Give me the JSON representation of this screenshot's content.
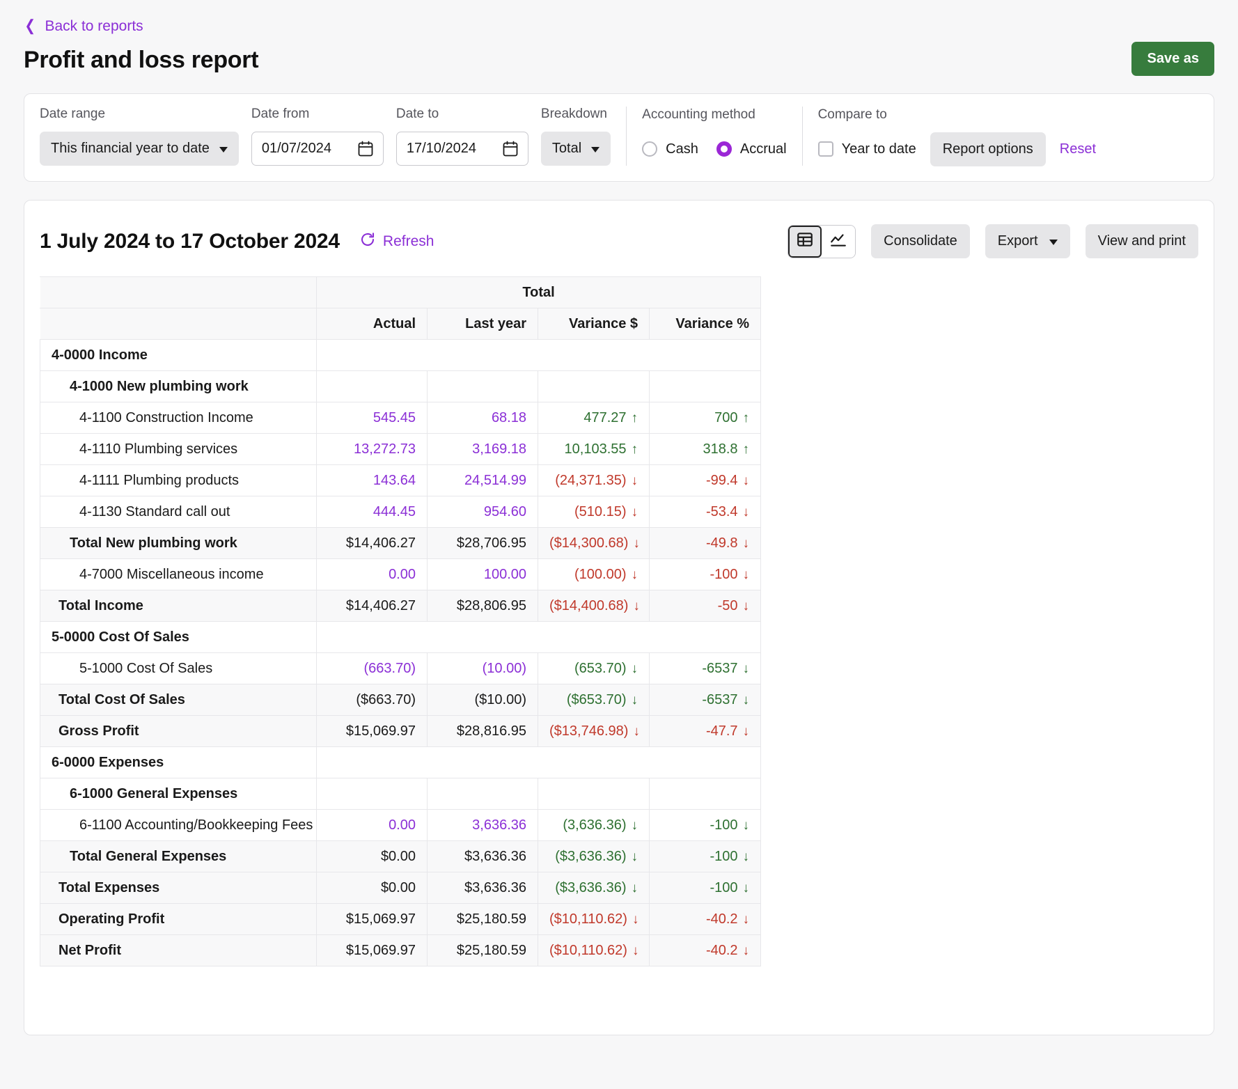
{
  "header": {
    "back_label": "Back to reports",
    "title": "Profit and loss report",
    "save_as_label": "Save as"
  },
  "filters": {
    "date_range": {
      "label": "Date range",
      "value": "This financial year to date"
    },
    "date_from": {
      "label": "Date from",
      "value": "01/07/2024"
    },
    "date_to": {
      "label": "Date to",
      "value": "17/10/2024"
    },
    "breakdown": {
      "label": "Breakdown",
      "value": "Total"
    },
    "accounting_method": {
      "label": "Accounting method",
      "options": [
        "Cash",
        "Accrual"
      ],
      "selected": "Accrual"
    },
    "compare_to": {
      "label": "Compare to",
      "option": "Year to date",
      "checked": false
    },
    "report_options_label": "Report options",
    "reset_label": "Reset"
  },
  "report": {
    "range_title": "1 July 2024 to 17 October 2024",
    "refresh_label": "Refresh",
    "view_table_icon": "table-view-icon",
    "view_chart_icon": "chart-view-icon",
    "consolidate_label": "Consolidate",
    "export_label": "Export",
    "view_and_print_label": "View and print"
  },
  "table": {
    "group_header": "Total",
    "columns": [
      "Actual",
      "Last year",
      "Variance $",
      "Variance %"
    ],
    "rows": [
      {
        "label": "4-0000 Income",
        "indent": "lvl0",
        "shade": false,
        "empty": true,
        "actual": "",
        "last_year": "",
        "var_d": "",
        "var_p": ""
      },
      {
        "label": "4-1000 New plumbing work",
        "indent": "lvl1",
        "shade": false,
        "empty": false,
        "actual": "",
        "last_year": "",
        "var_d": "",
        "var_p": ""
      },
      {
        "label": "4-1100 Construction Income",
        "indent": "lvl2",
        "shade": false,
        "empty": false,
        "actual": "545.45",
        "actual_color": "v-purple",
        "last_year": "68.18",
        "last_year_color": "v-purple",
        "var_d": "477.27",
        "var_d_color": "v-green",
        "var_d_arrow": "↑",
        "var_p": "700",
        "var_p_color": "v-green",
        "var_p_arrow": "↑"
      },
      {
        "label": "4-1110 Plumbing services",
        "indent": "lvl2",
        "shade": false,
        "empty": false,
        "actual": "13,272.73",
        "actual_color": "v-purple",
        "last_year": "3,169.18",
        "last_year_color": "v-purple",
        "var_d": "10,103.55",
        "var_d_color": "v-green",
        "var_d_arrow": "↑",
        "var_p": "318.8",
        "var_p_color": "v-green",
        "var_p_arrow": "↑"
      },
      {
        "label": "4-1111 Plumbing products",
        "indent": "lvl2",
        "shade": false,
        "empty": false,
        "actual": "143.64",
        "actual_color": "v-purple",
        "last_year": "24,514.99",
        "last_year_color": "v-purple",
        "var_d": "(24,371.35)",
        "var_d_color": "v-red",
        "var_d_arrow": "↓",
        "var_p": "-99.4",
        "var_p_color": "v-red",
        "var_p_arrow": "↓"
      },
      {
        "label": "4-1130 Standard call out",
        "indent": "lvl2",
        "shade": false,
        "empty": false,
        "actual": "444.45",
        "actual_color": "v-purple",
        "last_year": "954.60",
        "last_year_color": "v-purple",
        "var_d": "(510.15)",
        "var_d_color": "v-red",
        "var_d_arrow": "↓",
        "var_p": "-53.4",
        "var_p_color": "v-red",
        "var_p_arrow": "↓"
      },
      {
        "label": "Total New plumbing work",
        "indent": "lvl-total1",
        "shade": true,
        "empty": false,
        "actual": "$14,406.27",
        "actual_color": "v-black",
        "last_year": "$28,706.95",
        "last_year_color": "v-black",
        "var_d": "($14,300.68)",
        "var_d_color": "v-red",
        "var_d_arrow": "↓",
        "var_p": "-49.8",
        "var_p_color": "v-red",
        "var_p_arrow": "↓"
      },
      {
        "label": "4-7000 Miscellaneous income",
        "indent": "lvl2",
        "shade": false,
        "empty": false,
        "actual": "0.00",
        "actual_color": "v-purple",
        "last_year": "100.00",
        "last_year_color": "v-purple",
        "var_d": "(100.00)",
        "var_d_color": "v-red",
        "var_d_arrow": "↓",
        "var_p": "-100",
        "var_p_color": "v-red",
        "var_p_arrow": "↓"
      },
      {
        "label": "Total Income",
        "indent": "lvl-total0",
        "shade": true,
        "empty": false,
        "actual": "$14,406.27",
        "actual_color": "v-black",
        "last_year": "$28,806.95",
        "last_year_color": "v-black",
        "var_d": "($14,400.68)",
        "var_d_color": "v-red",
        "var_d_arrow": "↓",
        "var_p": "-50",
        "var_p_color": "v-red",
        "var_p_arrow": "↓"
      },
      {
        "label": "5-0000 Cost Of Sales",
        "indent": "lvl0",
        "shade": false,
        "empty": true,
        "actual": "",
        "last_year": "",
        "var_d": "",
        "var_p": ""
      },
      {
        "label": "5-1000 Cost Of Sales",
        "indent": "lvl2",
        "shade": false,
        "empty": false,
        "actual": "(663.70)",
        "actual_color": "v-purple",
        "last_year": "(10.00)",
        "last_year_color": "v-purple",
        "var_d": "(653.70)",
        "var_d_color": "v-green",
        "var_d_arrow": "↓",
        "var_p": "-6537",
        "var_p_color": "v-green",
        "var_p_arrow": "↓"
      },
      {
        "label": "Total Cost Of Sales",
        "indent": "lvl-total0",
        "shade": true,
        "empty": false,
        "actual": "($663.70)",
        "actual_color": "v-black",
        "last_year": "($10.00)",
        "last_year_color": "v-black",
        "var_d": "($653.70)",
        "var_d_color": "v-green",
        "var_d_arrow": "↓",
        "var_p": "-6537",
        "var_p_color": "v-green",
        "var_p_arrow": "↓"
      },
      {
        "label": "Gross Profit",
        "indent": "lvl-total0",
        "shade": true,
        "empty": false,
        "actual": "$15,069.97",
        "actual_color": "v-black",
        "last_year": "$28,816.95",
        "last_year_color": "v-black",
        "var_d": "($13,746.98)",
        "var_d_color": "v-red",
        "var_d_arrow": "↓",
        "var_p": "-47.7",
        "var_p_color": "v-red",
        "var_p_arrow": "↓"
      },
      {
        "label": "6-0000 Expenses",
        "indent": "lvl0",
        "shade": false,
        "empty": true,
        "actual": "",
        "last_year": "",
        "var_d": "",
        "var_p": ""
      },
      {
        "label": "6-1000 General Expenses",
        "indent": "lvl1",
        "shade": false,
        "empty": false,
        "actual": "",
        "last_year": "",
        "var_d": "",
        "var_p": ""
      },
      {
        "label": "6-1100 Accounting/Bookkeeping Fees",
        "indent": "lvl2",
        "shade": false,
        "empty": false,
        "actual": "0.00",
        "actual_color": "v-purple",
        "last_year": "3,636.36",
        "last_year_color": "v-purple",
        "var_d": "(3,636.36)",
        "var_d_color": "v-green",
        "var_d_arrow": "↓",
        "var_p": "-100",
        "var_p_color": "v-green",
        "var_p_arrow": "↓"
      },
      {
        "label": "Total General Expenses",
        "indent": "lvl-total1",
        "shade": true,
        "empty": false,
        "actual": "$0.00",
        "actual_color": "v-black",
        "last_year": "$3,636.36",
        "last_year_color": "v-black",
        "var_d": "($3,636.36)",
        "var_d_color": "v-green",
        "var_d_arrow": "↓",
        "var_p": "-100",
        "var_p_color": "v-green",
        "var_p_arrow": "↓"
      },
      {
        "label": "Total Expenses",
        "indent": "lvl-total0",
        "shade": true,
        "empty": false,
        "actual": "$0.00",
        "actual_color": "v-black",
        "last_year": "$3,636.36",
        "last_year_color": "v-black",
        "var_d": "($3,636.36)",
        "var_d_color": "v-green",
        "var_d_arrow": "↓",
        "var_p": "-100",
        "var_p_color": "v-green",
        "var_p_arrow": "↓"
      },
      {
        "label": "Operating Profit",
        "indent": "lvl-total0",
        "shade": true,
        "empty": false,
        "actual": "$15,069.97",
        "actual_color": "v-black",
        "last_year": "$25,180.59",
        "last_year_color": "v-black",
        "var_d": "($10,110.62)",
        "var_d_color": "v-red",
        "var_d_arrow": "↓",
        "var_p": "-40.2",
        "var_p_color": "v-red",
        "var_p_arrow": "↓"
      },
      {
        "label": "Net Profit",
        "indent": "lvl-total0",
        "shade": true,
        "empty": false,
        "actual": "$15,069.97",
        "actual_color": "v-black",
        "last_year": "$25,180.59",
        "last_year_color": "v-black",
        "var_d": "($10,110.62)",
        "var_d_color": "v-red",
        "var_d_arrow": "↓",
        "var_p": "-40.2",
        "var_p_color": "v-red",
        "var_p_arrow": "↓"
      }
    ]
  },
  "colors": {
    "accent_purple": "#8b2fd6",
    "save_green": "#377c3d",
    "positive_green": "#2e7031",
    "negative_red": "#c0392b",
    "radio_selected": "#9b27d6"
  }
}
